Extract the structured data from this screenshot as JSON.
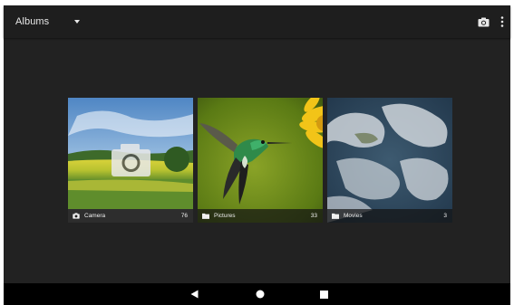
{
  "appbar": {
    "spinner_label": "Albums",
    "spinner_icon": "dropdown-caret",
    "actions": [
      {
        "icon": "camera-icon"
      },
      {
        "icon": "overflow-menu-icon"
      }
    ]
  },
  "albums": [
    {
      "name": "Camera",
      "count": "76",
      "icon": "camera-icon"
    },
    {
      "name": "Pictures",
      "count": "33",
      "icon": "folder-icon"
    },
    {
      "name": "Movies",
      "count": "3",
      "icon": "folder-icon"
    }
  ],
  "navbar": {
    "buttons": [
      {
        "icon": "back-icon"
      },
      {
        "icon": "home-icon"
      },
      {
        "icon": "recents-icon"
      }
    ]
  },
  "colors": {
    "appbar_bg": "#1e1e1e",
    "content_bg": "#222222",
    "navbar_bg": "#000000",
    "text": "#e8e8e8"
  }
}
